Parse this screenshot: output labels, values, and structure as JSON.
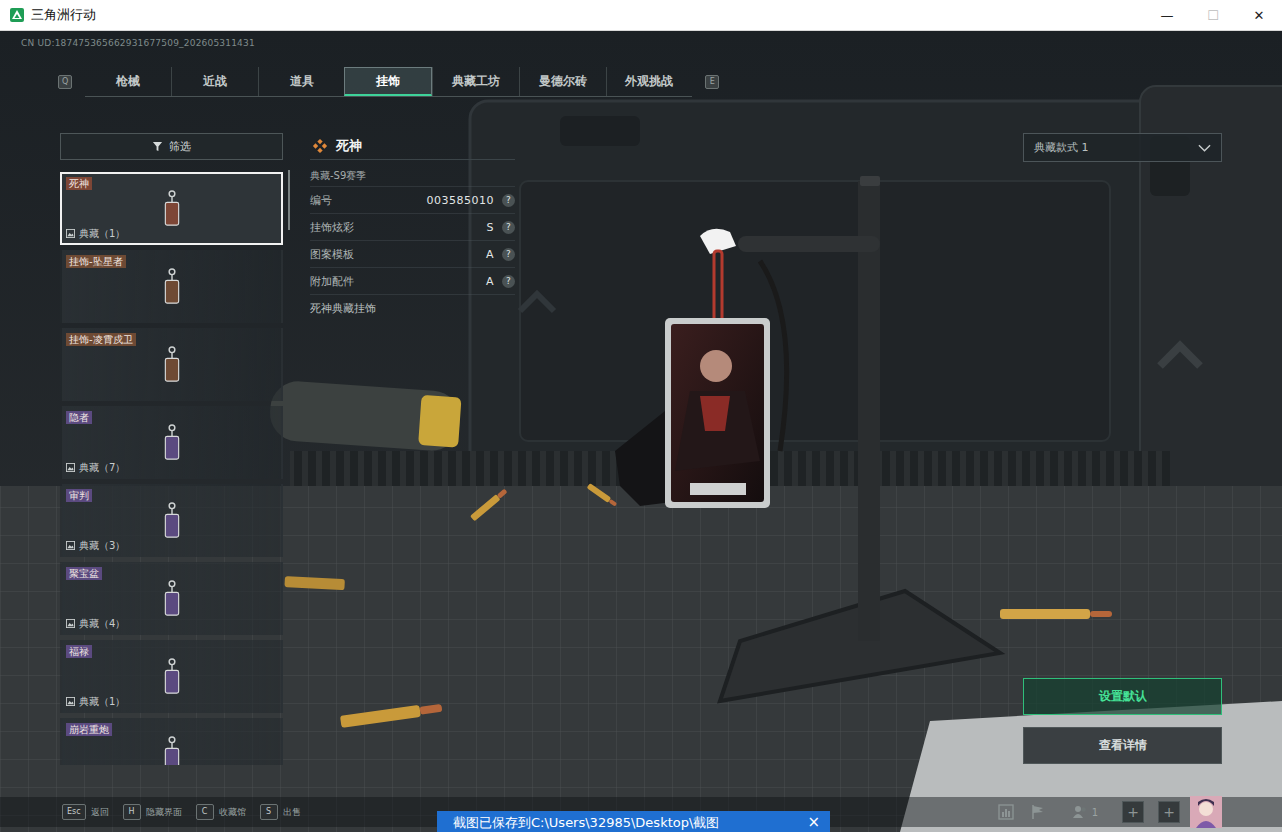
{
  "window": {
    "title": "三角洲行动",
    "controls": [
      {
        "glyph": "—",
        "disabled": false
      },
      {
        "glyph": "☐",
        "disabled": true
      },
      {
        "glyph": "✕",
        "disabled": false
      }
    ]
  },
  "uid": "CN UD:187475365662931677509_202605311431",
  "tabs": {
    "prev_key": "Q",
    "next_key": "E",
    "items": [
      {
        "label": "枪械",
        "selected": false
      },
      {
        "label": "近战",
        "selected": false
      },
      {
        "label": "道具",
        "selected": false
      },
      {
        "label": "挂饰",
        "selected": true
      },
      {
        "label": "典藏工坊",
        "selected": false
      },
      {
        "label": "曼德尔砖",
        "selected": false
      },
      {
        "label": "外观挑战",
        "selected": false
      }
    ]
  },
  "filter": {
    "label": "筛选"
  },
  "items": [
    {
      "name": "死神",
      "tag": "典藏（1）",
      "color": "#7d4636",
      "selected": true
    },
    {
      "name": "挂饰-坠星者",
      "color": "#6e4a34",
      "selected": false
    },
    {
      "name": "挂饰-凌霄戍卫",
      "color": "#6e4a34",
      "selected": false
    },
    {
      "name": "隐者",
      "tag": "典藏（7）",
      "color": "#5b4a80",
      "selected": false
    },
    {
      "name": "审判",
      "tag": "典藏（3）",
      "color": "#5b4a80",
      "selected": false
    },
    {
      "name": "聚宝盆",
      "tag": "典藏（4）",
      "color": "#5b4a80",
      "selected": false
    },
    {
      "name": "福禄",
      "tag": "典藏（1）",
      "color": "#5b4a80",
      "selected": false
    },
    {
      "name": "崩岩重炮",
      "color": "#5b4a80",
      "selected": false
    }
  ],
  "detail": {
    "title": "死神",
    "subtitle": "典藏-S9赛季",
    "rows": [
      {
        "label": "编号",
        "value": "003585010",
        "help": "?"
      },
      {
        "label": "挂饰炫彩",
        "value": "S",
        "help": "?"
      },
      {
        "label": "图案模板",
        "value": "A",
        "help": "?"
      },
      {
        "label": "附加配件",
        "value": "A",
        "help": "?"
      }
    ],
    "description": "死神典藏挂饰"
  },
  "style_select": {
    "value": "典藏款式 1"
  },
  "actions": [
    {
      "label": "设置默认",
      "kind": "primary"
    },
    {
      "label": "查看详情",
      "kind": "secondary"
    }
  ],
  "bottom_keys": [
    {
      "key": "Esc",
      "label": "返回"
    },
    {
      "key": "H",
      "label": "隐藏界面"
    },
    {
      "key": "C",
      "label": "收藏馆"
    },
    {
      "key": "S",
      "label": "出售"
    }
  ],
  "status": {
    "party_count": "1",
    "add_slots": [
      "+",
      "+"
    ]
  },
  "toast": {
    "text": "截图已保存到C:\\Users\\32985\\Desktop\\截图",
    "close": "×"
  }
}
